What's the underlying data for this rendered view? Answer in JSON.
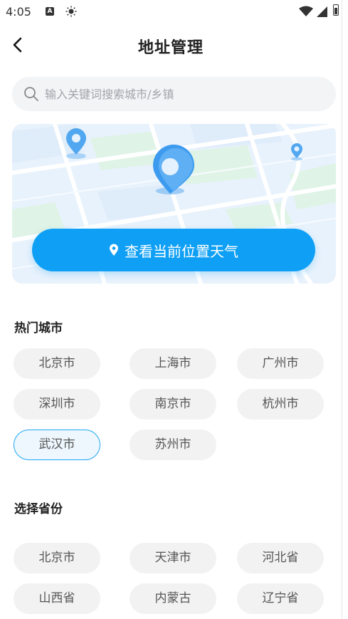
{
  "status_bar": {
    "time": "4:05",
    "a_icon_letter": "A"
  },
  "header": {
    "title": "地址管理"
  },
  "search": {
    "placeholder": "输入关键词搜索城市/乡镇"
  },
  "locate": {
    "button_label": "查看当前位置天气"
  },
  "hot_cities": {
    "title": "热门城市",
    "items": [
      "北京市",
      "上海市",
      "广州市",
      "深圳市",
      "南京市",
      "杭州市",
      "武汉市",
      "苏州市"
    ],
    "selected": "武汉市"
  },
  "provinces": {
    "title": "选择省份",
    "items": [
      "北京市",
      "天津市",
      "河北省",
      "山西省",
      "内蒙古",
      "辽宁省"
    ]
  },
  "colors": {
    "accent": "#0fa0f5",
    "chip_bg": "#f2f2f3",
    "selected_border": "#1ea6f3"
  }
}
